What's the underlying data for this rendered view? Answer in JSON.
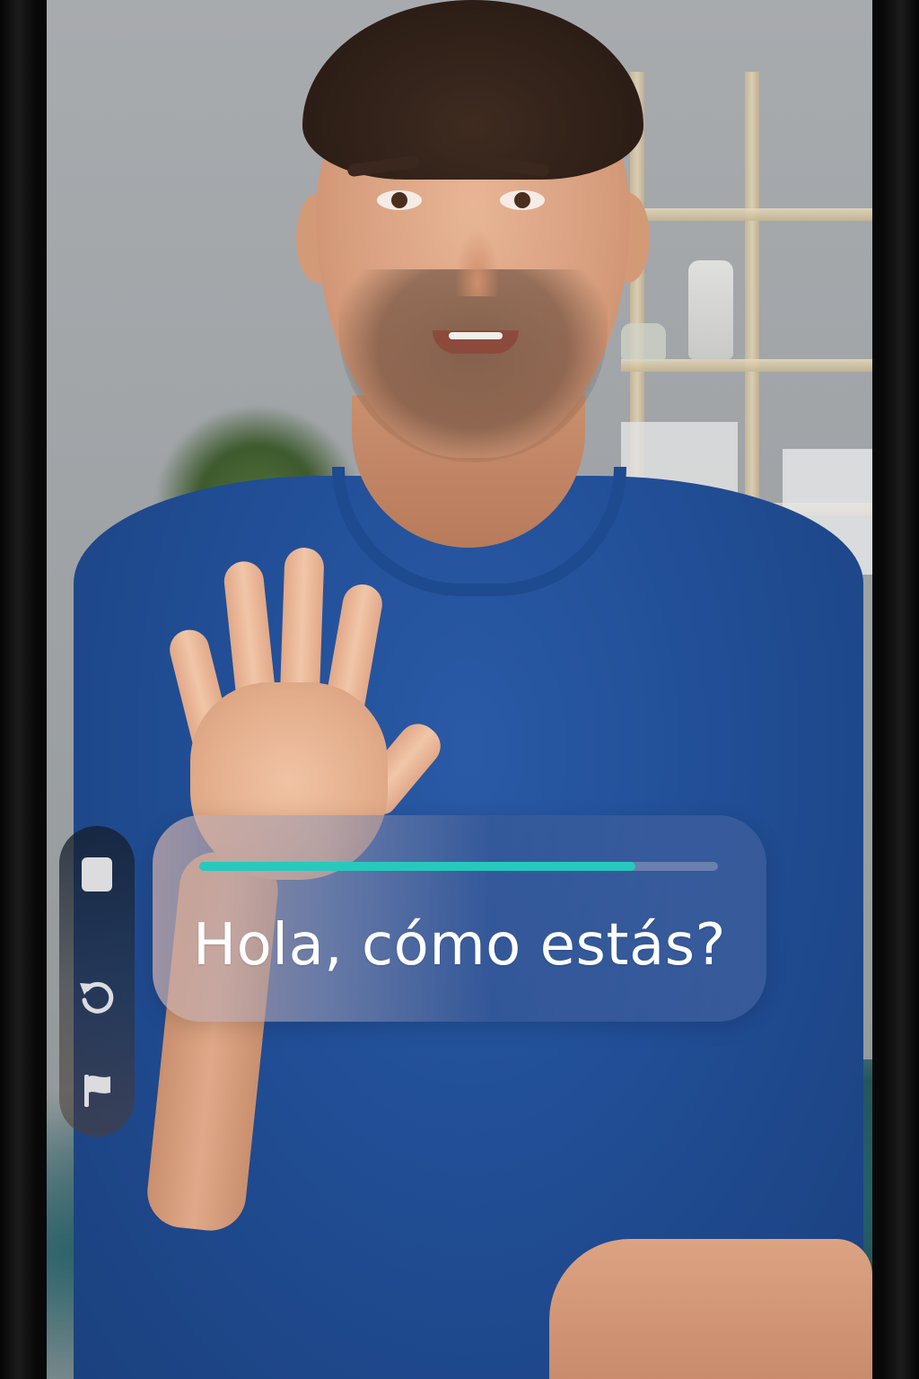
{
  "caption": {
    "text": "Hola, cómo estás?",
    "progress": 0.84
  },
  "controls": [
    {
      "icon": "stop-icon"
    },
    {
      "icon": "restart-icon"
    },
    {
      "icon": "flag-icon"
    }
  ],
  "colors": {
    "progress_accent": "#27c9bd",
    "caption_text": "#ffffff",
    "icon_color": "#dcdcde"
  }
}
